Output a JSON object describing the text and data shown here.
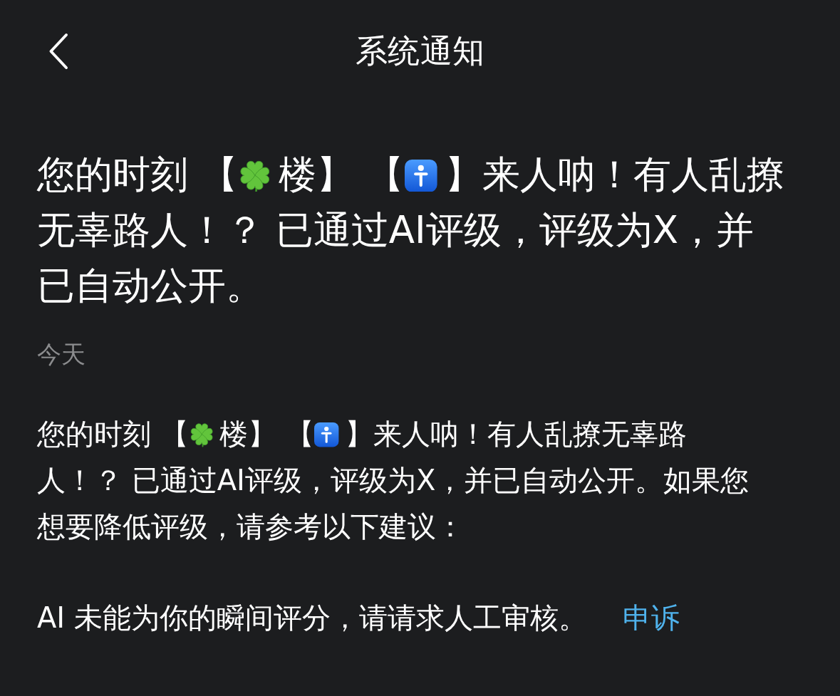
{
  "header": {
    "title": "系统通知"
  },
  "notification": {
    "headline_parts": [
      "您的时刻 【",
      "楼】 【",
      "】来人呐！有人乱撩无辜路人！？ 已通过AI评级，评级为X，并已自动公开。"
    ],
    "date": "今天",
    "body_parts": [
      "您的时刻 【",
      "楼】 【",
      "】来人呐！有人乱撩无辜路人！？ 已通过AI评级，评级为X，并已自动公开。如果您想要降低评级，请参考以下建议："
    ],
    "notice": "AI 未能为你的瞬间评分，请请求人工审核。",
    "appeal_link": "申诉"
  }
}
